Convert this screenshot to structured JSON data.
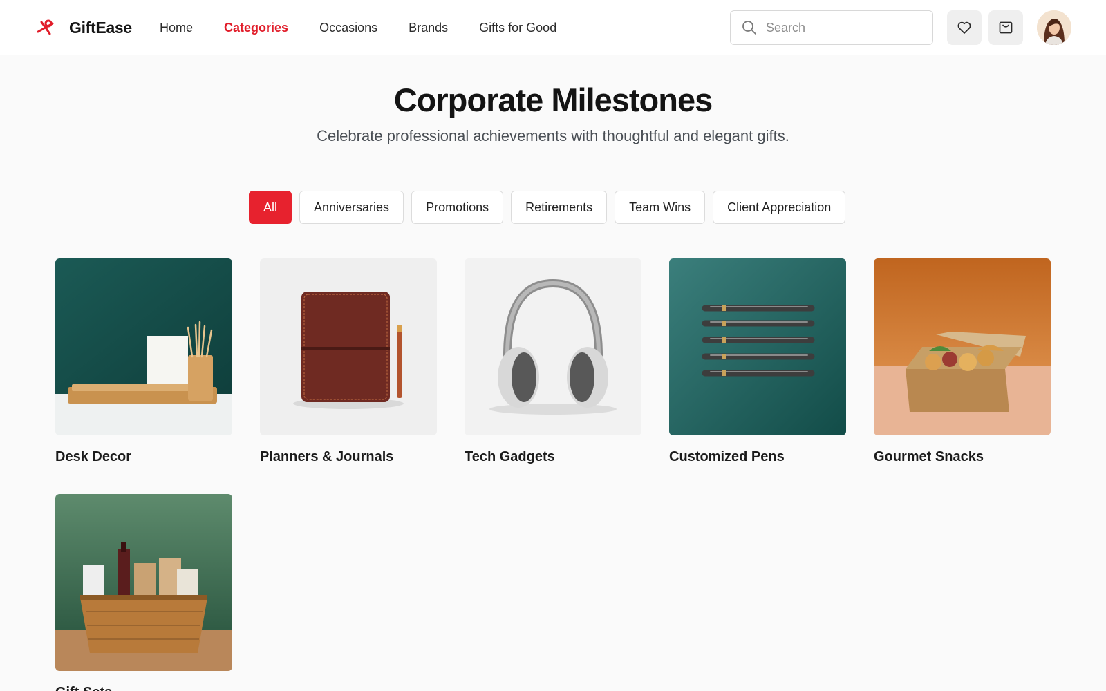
{
  "brand": {
    "name": "GiftEase",
    "accent_color": "#e11d2a"
  },
  "nav": {
    "items": [
      {
        "label": "Home",
        "active": false
      },
      {
        "label": "Categories",
        "active": true
      },
      {
        "label": "Occasions",
        "active": false
      },
      {
        "label": "Brands",
        "active": false
      },
      {
        "label": "Gifts for Good",
        "active": false
      }
    ]
  },
  "search": {
    "placeholder": "Search",
    "value": ""
  },
  "header_icons": [
    "search-icon",
    "heart-icon",
    "bag-icon",
    "avatar"
  ],
  "page": {
    "title": "Corporate Milestones",
    "subtitle": "Celebrate professional achievements with thoughtful and elegant gifts."
  },
  "filters": {
    "items": [
      {
        "label": "All",
        "active": true
      },
      {
        "label": "Anniversaries",
        "active": false
      },
      {
        "label": "Promotions",
        "active": false
      },
      {
        "label": "Retirements",
        "active": false
      },
      {
        "label": "Team Wins",
        "active": false
      },
      {
        "label": "Client Appreciation",
        "active": false
      }
    ],
    "active_color": "#e7222e"
  },
  "categories": {
    "items": [
      {
        "label": "Desk Decor",
        "image": "desk-decor-image"
      },
      {
        "label": "Planners & Journals",
        "image": "planner-journal-image"
      },
      {
        "label": "Tech Gadgets",
        "image": "headphones-image"
      },
      {
        "label": "Customized Pens",
        "image": "pens-image"
      },
      {
        "label": "Gourmet Snacks",
        "image": "snack-box-image"
      },
      {
        "label": "Gift Sets",
        "image": "gift-basket-image"
      }
    ]
  }
}
